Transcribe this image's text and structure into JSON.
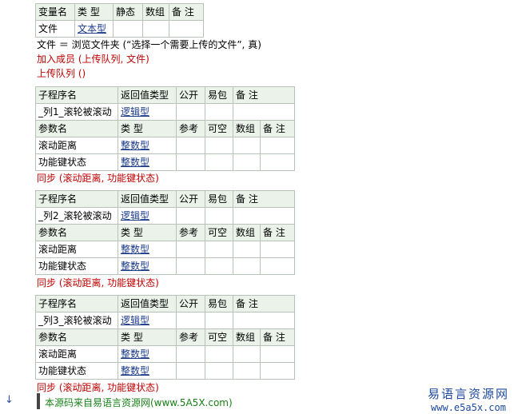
{
  "var_table": {
    "headers": [
      "变量名",
      "类 型",
      "静态",
      "数组",
      "备 注"
    ],
    "row": [
      "文件",
      "文本型",
      "",
      "",
      ""
    ]
  },
  "code_lines": {
    "line1": "文件 ＝ 浏览文件夹 (“选择一个需要上传的文件”, 真)",
    "line2": "加入成员 (上传队列, 文件)",
    "line3": "上传队列 ()"
  },
  "sub_headers": {
    "sub_name": "子程序名",
    "return_type": "返回值类型",
    "public": "公开",
    "easy_pack": "易包",
    "note": "备 注"
  },
  "param_headers": {
    "param_name": "参数名",
    "type": "类 型",
    "ref": "参考",
    "nullable": "可空",
    "array": "数组",
    "note": "备 注"
  },
  "subroutines": [
    {
      "name": "_列1_滚轮被滚动",
      "return_type": "逻辑型",
      "params": [
        {
          "name": "滚动距离",
          "type": "整数型"
        },
        {
          "name": "功能键状态",
          "type": "整数型"
        }
      ],
      "sync_line": "同步 (滚动距离, 功能键状态)"
    },
    {
      "name": "_列2_滚轮被滚动",
      "return_type": "逻辑型",
      "params": [
        {
          "name": "滚动距离",
          "type": "整数型"
        },
        {
          "name": "功能键状态",
          "type": "整数型"
        }
      ],
      "sync_line": "同步 (滚动距离, 功能键状态)"
    },
    {
      "name": "_列3_滚轮被滚动",
      "return_type": "逻辑型",
      "params": [
        {
          "name": "滚动距离",
          "type": "整数型"
        },
        {
          "name": "功能键状态",
          "type": "整数型"
        }
      ],
      "sync_line": "同步 (滚动距离, 功能键状态)"
    }
  ],
  "footer": {
    "source_line": "本源码来自易语言资源网(www.5A5X.com)",
    "gutter_mark": "↓"
  },
  "watermark": {
    "cn": "易语言资源网",
    "en": "www.e5a5x.com"
  }
}
